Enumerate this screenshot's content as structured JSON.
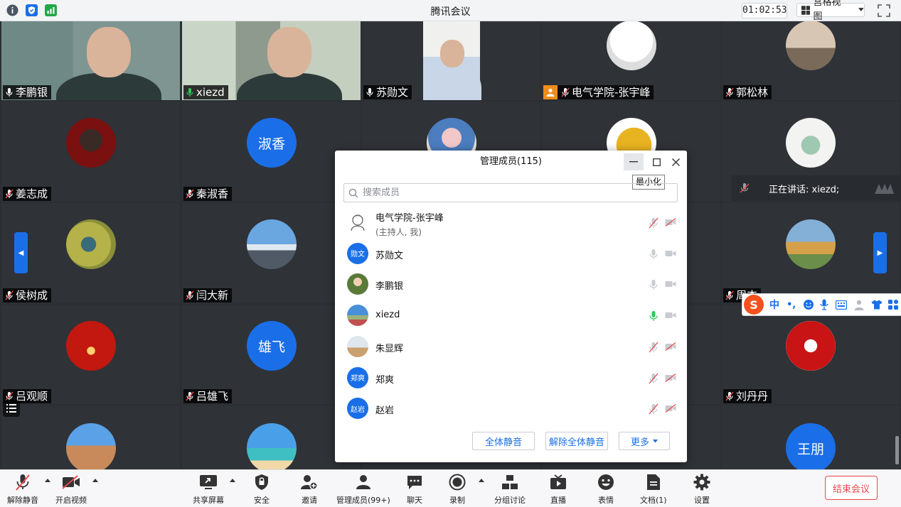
{
  "window": {
    "title": "腾讯会议",
    "timer": "01:02:53",
    "view_label": "宫格视图"
  },
  "colors": {
    "accent": "#1a6fe8",
    "end": "#e5484d",
    "mic_active": "#34c759",
    "muted_red": "#e5484d"
  },
  "tiles": [
    {
      "name": "李鹏银",
      "type": "video"
    },
    {
      "name": "xiezd",
      "type": "video"
    },
    {
      "name": "苏勋文",
      "type": "video"
    },
    {
      "name": "电气学院-张宇峰",
      "type": "avatar"
    },
    {
      "name": "郭松林",
      "type": "avatar"
    },
    {
      "name": "姜志成",
      "type": "avatar"
    },
    {
      "name": "秦淑香",
      "type": "text",
      "avatar_text": "淑香"
    },
    {
      "name": "",
      "type": "avatar"
    },
    {
      "name": "",
      "type": "avatar"
    },
    {
      "name": "",
      "type": "avatar"
    },
    {
      "name": "侯树成",
      "type": "avatar"
    },
    {
      "name": "闫大新",
      "type": "avatar"
    },
    {
      "name": "",
      "type": "none"
    },
    {
      "name": "",
      "type": "none"
    },
    {
      "name": "周杰",
      "type": "avatar"
    },
    {
      "name": "吕观顺",
      "type": "avatar"
    },
    {
      "name": "吕雄飞",
      "type": "text",
      "avatar_text": "雄飞"
    },
    {
      "name": "",
      "type": "none"
    },
    {
      "name": "",
      "type": "none"
    },
    {
      "name": "刘丹丹",
      "type": "avatar"
    },
    {
      "name": "",
      "type": "avatar"
    },
    {
      "name": "",
      "type": "avatar"
    },
    {
      "name": "",
      "type": "none"
    },
    {
      "name": "",
      "type": "none"
    },
    {
      "name": "",
      "type": "text",
      "avatar_text": "王朋"
    }
  ],
  "speaking": {
    "label": "正在讲话: xiezd;"
  },
  "dialog": {
    "title": "管理成员(115)",
    "tooltip": "最小化",
    "search_placeholder": "搜索成员",
    "members": [
      {
        "name": "电气学院-张宇峰",
        "sub": "(主持人, 我)",
        "avatar": "sketch",
        "mic": "muted",
        "cam": "off"
      },
      {
        "name": "苏勋文",
        "avatar_text": "勋文",
        "mic": "on",
        "cam": "off-gray"
      },
      {
        "name": "李鹏银",
        "avatar": "photo",
        "mic": "on",
        "cam": "off-gray"
      },
      {
        "name": "xiezd",
        "avatar": "photo",
        "mic": "active",
        "cam": "off-gray"
      },
      {
        "name": "朱显辉",
        "avatar": "photo",
        "mic": "muted",
        "cam": "off"
      },
      {
        "name": "郑爽",
        "avatar_text": "郑爽",
        "mic": "muted",
        "cam": "off"
      },
      {
        "name": "赵岩",
        "avatar_text": "赵岩",
        "mic": "muted",
        "cam": "off"
      }
    ],
    "buttons": {
      "mute_all": "全体静音",
      "unmute_all": "解除全体静音",
      "more": "更多"
    }
  },
  "ime": {
    "lang": "中",
    "punct": "•,"
  },
  "toolbar": {
    "unmute": "解除静音",
    "start_video": "开启视频",
    "share": "共享屏幕",
    "security": "安全",
    "invite": "邀请",
    "members": "管理成员(99+)",
    "chat": "聊天",
    "record": "录制",
    "breakout": "分组讨论",
    "live": "直播",
    "reactions": "表情",
    "docs": "文档(1)",
    "settings": "设置",
    "end": "结束会议"
  }
}
